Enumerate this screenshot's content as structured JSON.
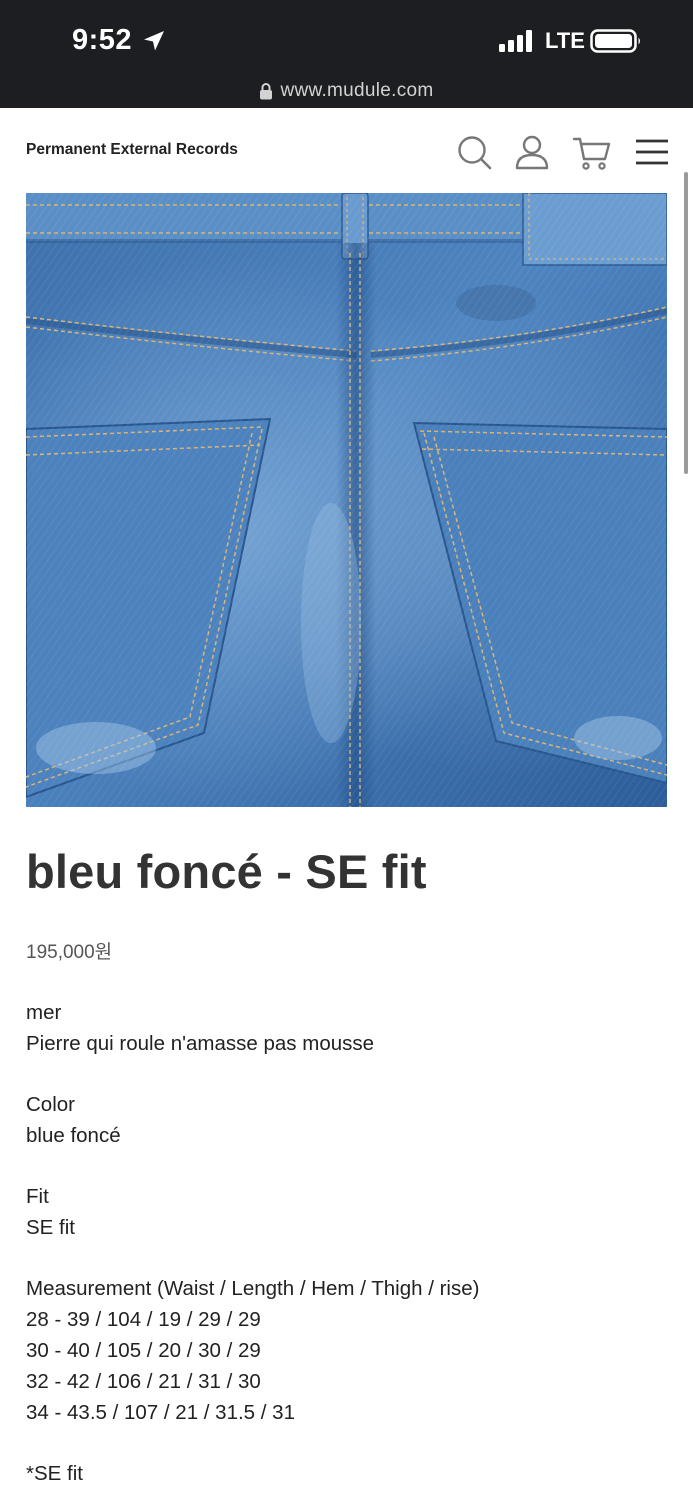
{
  "status_bar": {
    "time": "9:52",
    "network": "LTE",
    "url": "www.mudule.com"
  },
  "header": {
    "brand": "Permanent External Records",
    "icons": [
      "search-icon",
      "user-icon",
      "cart-icon",
      "menu-icon"
    ]
  },
  "product": {
    "image_alt": "Back of blue denim jeans showing two rear pockets",
    "title": "bleu foncé - SE fit",
    "price": "195,000원",
    "series_label": "mer",
    "tagline": "Pierre qui roule n'amasse pas mousse",
    "color_label": "Color",
    "color_value": "blue foncé",
    "fit_label": "Fit",
    "fit_value": "SE fit",
    "measurement_label": "Measurement (Waist / Length / Hem / Thigh / rise)",
    "measurements": [
      "28 - 39 / 104 / 19 / 29 / 29",
      "30 - 40 / 105 / 20 / 30 / 29",
      "32 - 42 / 106 / 21 / 31 / 30",
      "34 - 43.5 / 107 / 21 / 31.5 / 31"
    ],
    "se_fit_label": "*SE fit"
  },
  "colors": {
    "status_bg": "#1c1e21",
    "denim_dark": "#2e5f9c",
    "denim_light": "#6f9fd0",
    "stitch": "#c9a062"
  }
}
